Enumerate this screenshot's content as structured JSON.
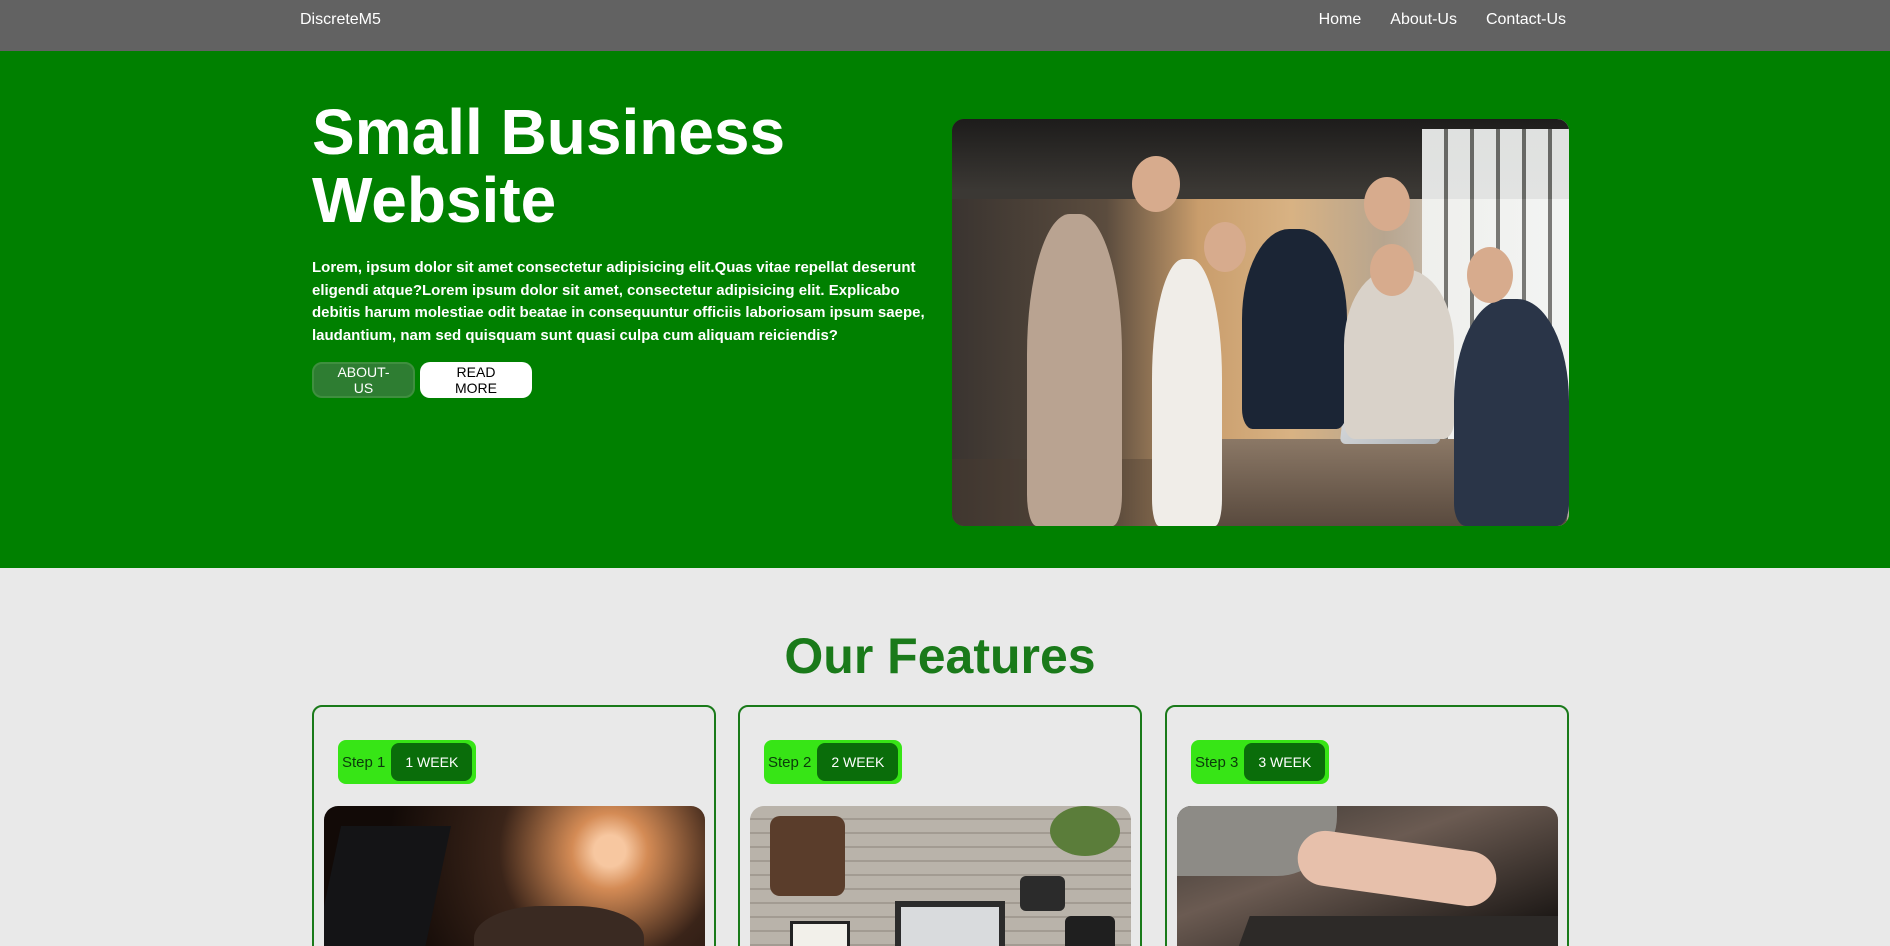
{
  "navbar": {
    "brand": "DiscreteM5",
    "links": [
      "Home",
      "About-Us",
      "Contact-Us"
    ]
  },
  "hero": {
    "title": "Small Business Website",
    "text": "Lorem, ipsum dolor sit amet consectetur adipisicing elit.Quas vitae repellat deserunt eligendi atque?Lorem ipsum dolor sit amet, consectetur adipisicing elit. Explicabo debitis harum molestiae odit beatae in consequuntur officiis laboriosam ipsum saepe, laudantium, nam sed quisquam sunt quasi culpa cum aliquam reiciendis?",
    "about_button": "ABOUT-US",
    "read_more_button": "READ MORE",
    "image_alt": "team-photo"
  },
  "features": {
    "title": "Our Features",
    "cards": [
      {
        "step": "Step 1",
        "duration": "1 WEEK"
      },
      {
        "step": "Step 2",
        "duration": "2 WEEK"
      },
      {
        "step": "Step 3",
        "duration": "3 WEEK"
      }
    ]
  },
  "colors": {
    "navbar": "#626262",
    "hero_bg": "#008000",
    "accent_green": "#1a7a1a",
    "step_green": "#37e516",
    "chip_green": "#0a6d0a",
    "page_bg": "#e9e9e9"
  }
}
